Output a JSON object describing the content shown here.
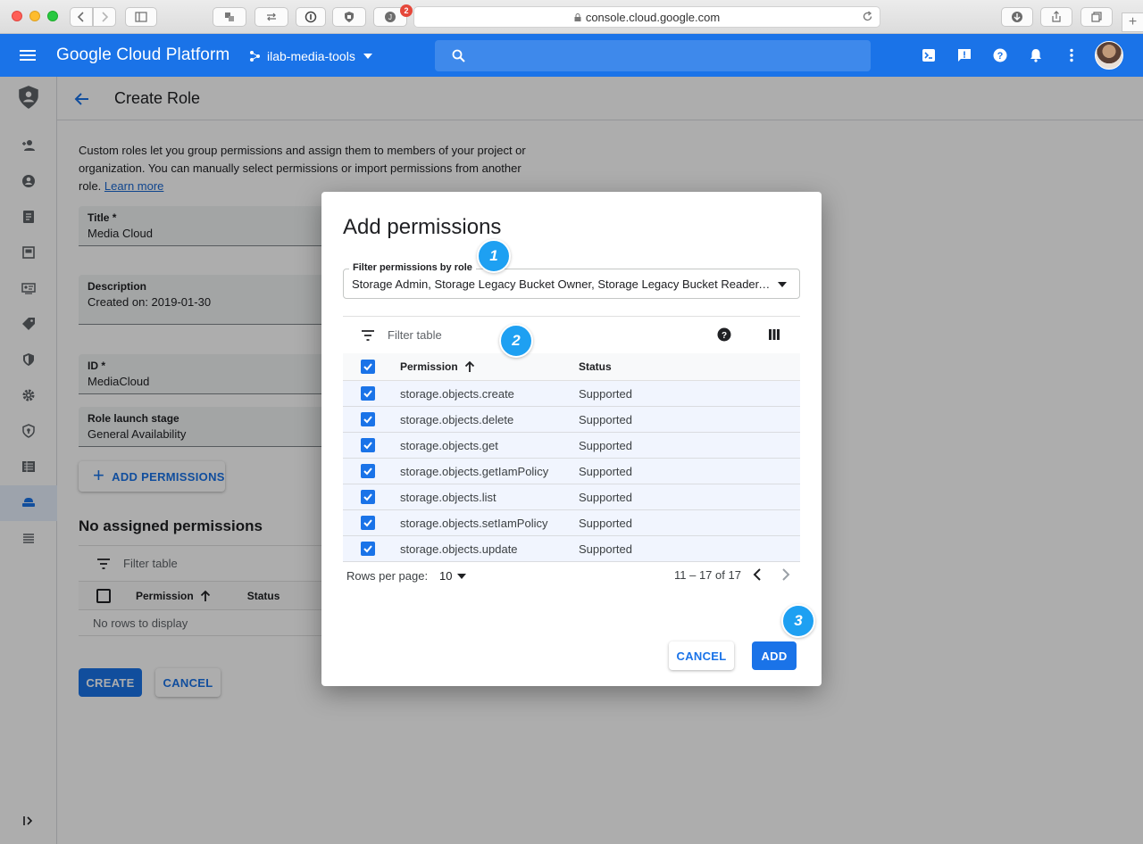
{
  "browser": {
    "url": "console.cloud.google.com",
    "extension_badge": "2"
  },
  "header": {
    "logo": "Google Cloud Platform",
    "project": "ilab-media-tools"
  },
  "page": {
    "title": "Create Role",
    "intro": "Custom roles let you group permissions and assign them to members of your project or organization. You can manually select permissions or import permissions from another role.",
    "learn_more": "Learn more",
    "fields": {
      "title_label": "Title",
      "title_value": "Media Cloud",
      "description_label": "Description",
      "description_value": "Created on: 2019-01-30",
      "id_label": "ID",
      "id_value": "MediaCloud",
      "stage_label": "Role launch stage",
      "stage_value": "General Availability"
    },
    "add_permissions": "ADD PERMISSIONS",
    "assigned_title": "No assigned permissions",
    "filter_placeholder": "Filter table",
    "col_permission": "Permission",
    "col_status": "Status",
    "empty": "No rows to display",
    "create": "CREATE",
    "cancel": "CANCEL"
  },
  "dialog": {
    "title": "Add permissions",
    "filter_label": "Filter permissions by role",
    "filter_value": "Storage Admin, Storage Legacy Bucket Owner, Storage Legacy Bucket Reader, Storage Legacy Object Owner, Storage Object Admin",
    "table_filter": "Filter table",
    "col_permission": "Permission",
    "col_status": "Status",
    "rows": [
      {
        "permission": "storage.objects.create",
        "status": "Supported"
      },
      {
        "permission": "storage.objects.delete",
        "status": "Supported"
      },
      {
        "permission": "storage.objects.get",
        "status": "Supported"
      },
      {
        "permission": "storage.objects.getIamPolicy",
        "status": "Supported"
      },
      {
        "permission": "storage.objects.list",
        "status": "Supported"
      },
      {
        "permission": "storage.objects.setIamPolicy",
        "status": "Supported"
      },
      {
        "permission": "storage.objects.update",
        "status": "Supported"
      }
    ],
    "rows_per_page_label": "Rows per page:",
    "rows_per_page": "10",
    "range": "11 – 17 of 17",
    "cancel": "CANCEL",
    "add": "ADD"
  },
  "callouts": [
    "1",
    "2",
    "3"
  ],
  "colors": {
    "brand": "#1a73e8",
    "callout": "#1ea0f2"
  }
}
